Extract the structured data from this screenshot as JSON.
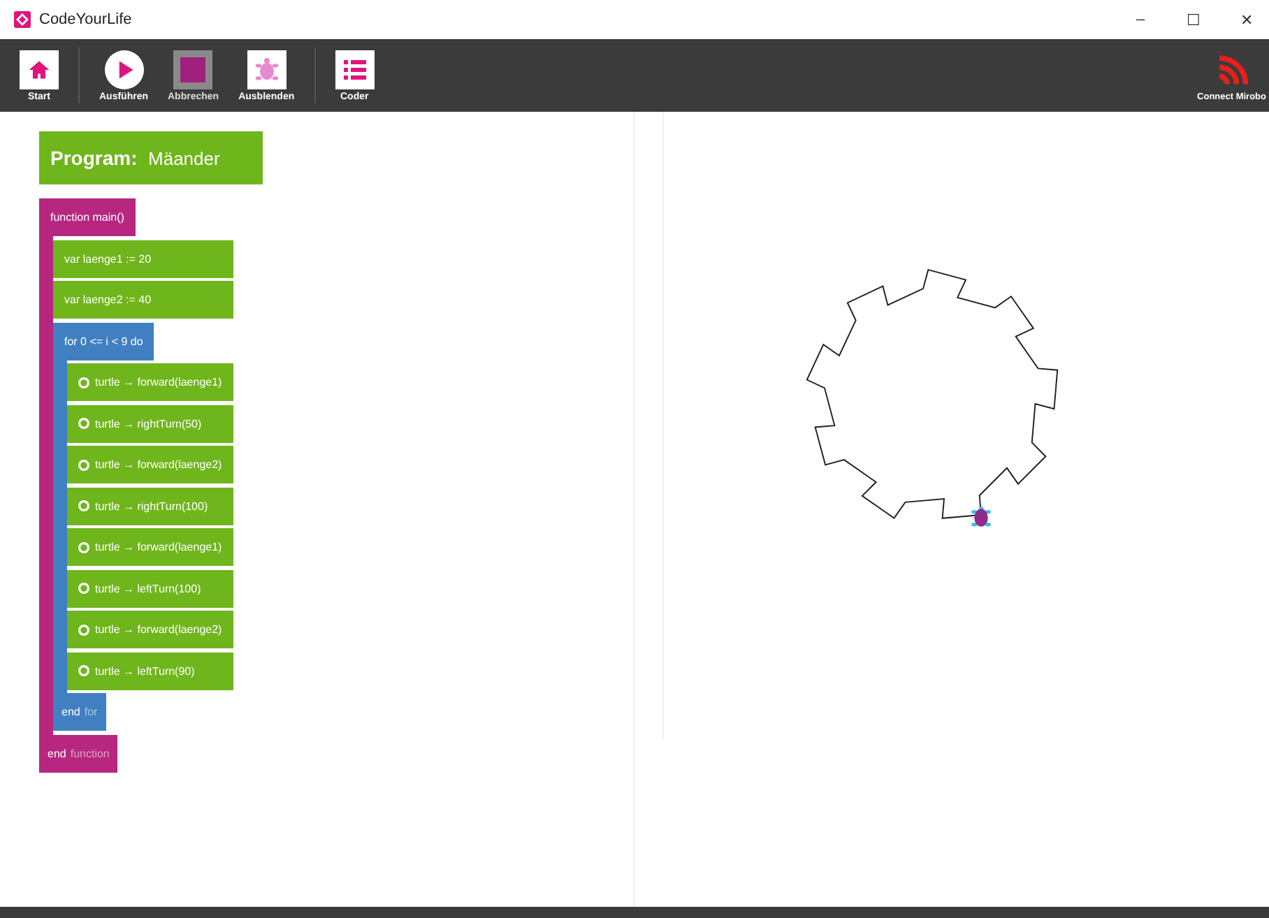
{
  "window": {
    "title": "CodeYourLife",
    "controls": [
      "–",
      "☐",
      "✕"
    ]
  },
  "toolbar": {
    "buttons": [
      {
        "label": "Start",
        "kind": "home",
        "disabled": false
      },
      {
        "label": "Ausführen",
        "kind": "play",
        "disabled": false
      },
      {
        "label": "Abbrechen",
        "kind": "stop",
        "disabled": true
      },
      {
        "label": "Ausblenden",
        "kind": "turtle",
        "disabled": false
      },
      {
        "label": "Coder",
        "kind": "list",
        "disabled": false
      }
    ],
    "connect": {
      "label": "Connect Mirobo"
    }
  },
  "program": {
    "label": "Program:",
    "name": "Mäander"
  },
  "code": {
    "kind": "function",
    "header": "function main()",
    "end_keyword": "end",
    "end_label": "function",
    "children": [
      {
        "kind": "var",
        "text": "var laenge1 := 20"
      },
      {
        "kind": "var",
        "text": "var laenge2 := 40"
      },
      {
        "kind": "for",
        "header": "for 0 <= i < 9 do",
        "end_keyword": "end",
        "end_label": "for",
        "children": [
          {
            "kind": "call",
            "text": "turtle → forward(laenge1)"
          },
          {
            "kind": "call",
            "text": "turtle → rightTurn(50)"
          },
          {
            "kind": "call",
            "text": "turtle → forward(laenge2)"
          },
          {
            "kind": "call",
            "text": "turtle → rightTurn(100)"
          },
          {
            "kind": "call",
            "text": "turtle → forward(laenge1)"
          },
          {
            "kind": "call",
            "text": "turtle → leftTurn(100)"
          },
          {
            "kind": "call",
            "text": "turtle → forward(laenge2)"
          },
          {
            "kind": "call",
            "text": "turtle → leftTurn(90)"
          }
        ]
      }
    ]
  }
}
